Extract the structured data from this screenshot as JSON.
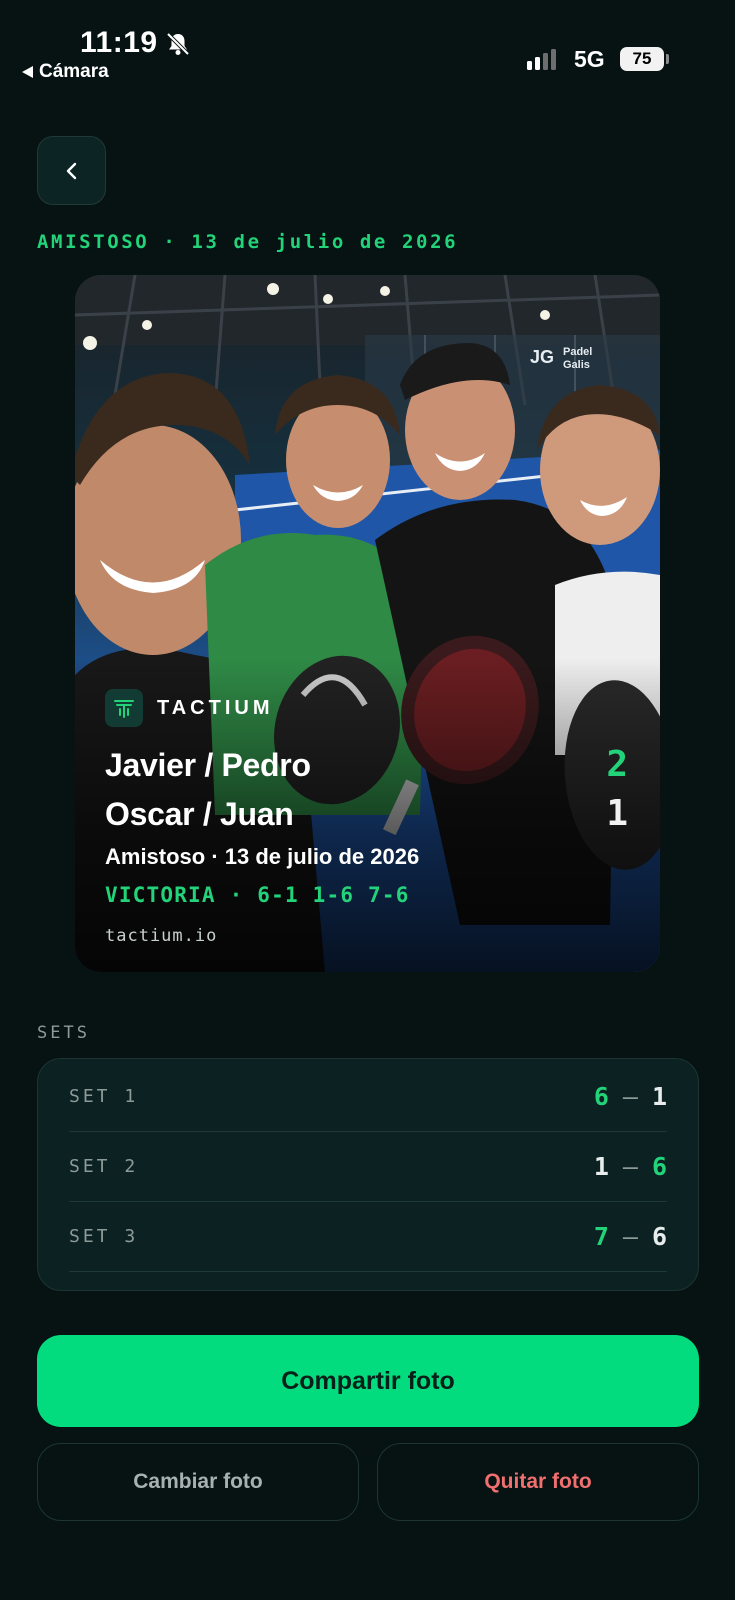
{
  "status_bar": {
    "time": "11:19",
    "back_app_label": "Cámara",
    "network": "5G",
    "battery": "75",
    "icons": [
      "bell-slash-icon",
      "signal-icon",
      "battery-icon"
    ]
  },
  "header": {
    "back_icon": "chevron-left-icon",
    "match_meta": "AMISTOSO · 13 de julio de 2026"
  },
  "photo_card": {
    "brand_name": "TACTIUM",
    "team_a": "Javier / Pedro",
    "team_b": "Oscar / Juan",
    "score_a": "2",
    "score_b": "1",
    "meta": "Amistoso · 13 de julio de 2026",
    "result": "VICTORIA · 6-1 1-6 7-6",
    "url": "tactium.io"
  },
  "sets": {
    "heading": "SETS",
    "rows": [
      {
        "label": "SET 1",
        "a": "6",
        "b": "1",
        "winner": "a"
      },
      {
        "label": "SET 2",
        "a": "1",
        "b": "6",
        "winner": "b"
      },
      {
        "label": "SET 3",
        "a": "7",
        "b": "6",
        "winner": "a"
      }
    ],
    "separator": "—"
  },
  "actions": {
    "share_label": "Compartir foto",
    "change_label": "Cambiar foto",
    "remove_label": "Quitar foto"
  },
  "colors": {
    "background": "#061312",
    "accent": "#03dc7e",
    "accent_text": "#22d37a",
    "panel": "#0c2121",
    "danger": "#f16f6f"
  }
}
